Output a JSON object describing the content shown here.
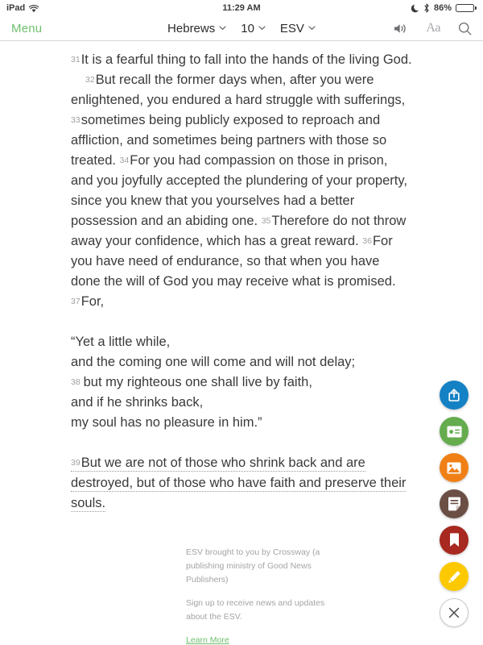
{
  "status_bar": {
    "device": "iPad",
    "wifi_icon": "wifi-icon",
    "time": "11:29 AM",
    "dnd_icon": "moon-icon",
    "bluetooth_icon": "bluetooth-icon",
    "battery_percent": "86%",
    "battery_level": 86
  },
  "toolbar": {
    "menu_label": "Menu",
    "book_label": "Hebrews",
    "chapter_label": "10",
    "version_label": "ESV",
    "audio_icon": "speaker-icon",
    "text_size_label": "Aa",
    "search_icon": "search-icon",
    "accent_color": "#6ec06e"
  },
  "passage": {
    "paragraphs": [
      {
        "indent": false,
        "segments": [
          {
            "verse": "31",
            "text": "It is a fearful thing to fall into the hands of the living God."
          }
        ]
      },
      {
        "indent": true,
        "segments": [
          {
            "verse": "32",
            "text": "But recall the former days when, after you were enlightened, you endured a hard struggle with sufferings,"
          },
          {
            "verse": "33",
            "text": "sometimes being publicly exposed to reproach and affliction, and sometimes being partners with those so treated."
          },
          {
            "verse": "34",
            "text": "For you had compassion on those in prison, and you joyfully accepted the plundering of your property, since you knew that you yourselves had a better possession and an abiding one."
          },
          {
            "verse": "35",
            "text": "Therefore do not throw away your confidence, which has a great reward."
          },
          {
            "verse": "36",
            "text": "For you have need of endurance, so that when you have done the will of God you may receive what is promised."
          },
          {
            "verse": "37",
            "text": "For,"
          }
        ]
      }
    ],
    "poetry_lines": [
      {
        "verse": "",
        "text": "“Yet a little while,"
      },
      {
        "verse": "",
        "text": "and the coming one will come and will not delay;"
      },
      {
        "verse": "38",
        "text": "but my righteous one shall live by faith,"
      },
      {
        "verse": "",
        "text": "and if he shrinks back,"
      },
      {
        "verse": "",
        "text": "my soul has no pleasure in him.”"
      }
    ],
    "highlighted_verse": {
      "verse": "39",
      "text": "But we are not of those who shrink back and are destroyed, but of those who have faith and preserve their souls."
    }
  },
  "footer": {
    "credit": "ESV brought to you by Crossway (a publishing ministry of Good News Publishers)",
    "signup": "Sign up to receive news and updates about the ESV.",
    "learn_more": "Learn More"
  },
  "action_buttons": [
    {
      "name": "share-button",
      "icon": "share-icon",
      "color": "#1481c4"
    },
    {
      "name": "note-card-button",
      "icon": "note-card-icon",
      "color": "#64ac4e"
    },
    {
      "name": "image-button",
      "icon": "image-icon",
      "color": "#f08016"
    },
    {
      "name": "note-button",
      "icon": "note-icon",
      "color": "#6b4f44"
    },
    {
      "name": "bookmark-button",
      "icon": "bookmark-icon",
      "color": "#a7291f"
    },
    {
      "name": "highlight-button",
      "icon": "pencil-icon",
      "color": "#fcc900"
    },
    {
      "name": "close-button",
      "icon": "close-icon",
      "color": "#ffffff"
    }
  ]
}
